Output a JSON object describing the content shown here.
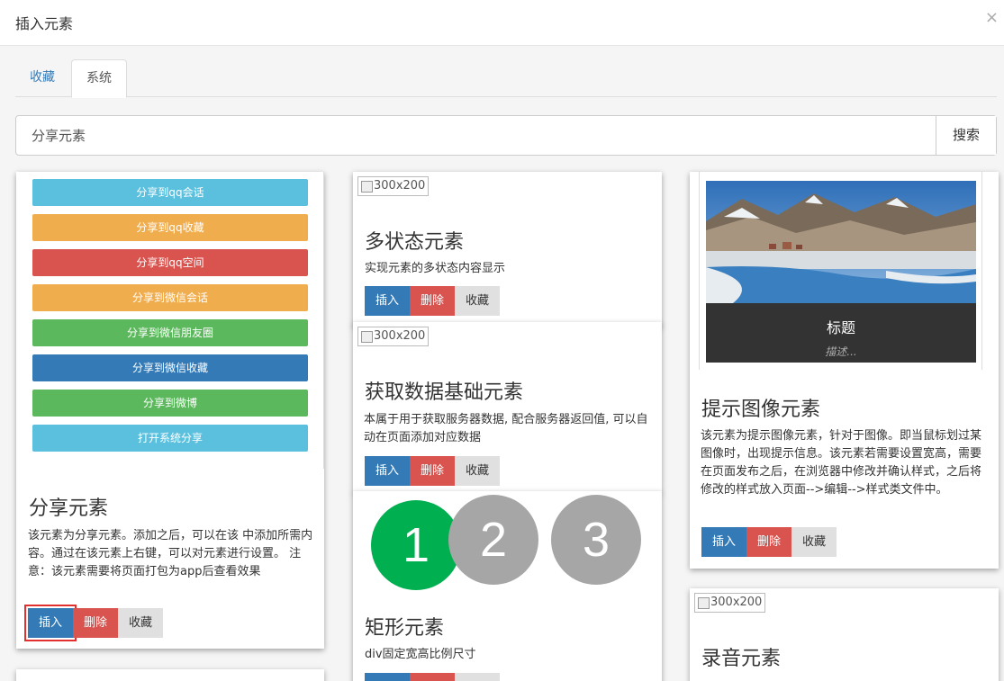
{
  "modal": {
    "title": "插入元素",
    "close": "×"
  },
  "tabs": [
    {
      "label": "收藏"
    },
    {
      "label": "系统"
    }
  ],
  "search": {
    "value": "分享元素",
    "button": "搜索"
  },
  "buttons": {
    "insert": "插入",
    "delete": "删除",
    "favorite": "收藏"
  },
  "cards": {
    "share": {
      "title": "分享元素",
      "desc": "该元素为分享元素。添加之后，可以在该 中添加所需内容。通过在该元素上右键，可以对元素进行设置。 注意：该元素需要将页面打包为app后查看效果",
      "share_buttons": [
        {
          "label": "分享到qq会话",
          "color": "#5bc0de"
        },
        {
          "label": "分享到qq收藏",
          "color": "#f0ad4e"
        },
        {
          "label": "分享到qq空间",
          "color": "#d9534f"
        },
        {
          "label": "分享到微信会话",
          "color": "#f0ad4e"
        },
        {
          "label": "分享到微信朋友圈",
          "color": "#5cb85c"
        },
        {
          "label": "分享到微信收藏",
          "color": "#337ab7"
        },
        {
          "label": "分享到微博",
          "color": "#5cb85c"
        },
        {
          "label": "打开系统分享",
          "color": "#5bc0de"
        }
      ]
    },
    "multistate": {
      "image": "300x200",
      "title": "多状态元素",
      "desc": "实现元素的多状态内容显示"
    },
    "data": {
      "image": "300x200",
      "title": "获取数据基础元素",
      "desc": "本属于用于获取服务器数据, 配合服务器返回值, 可以自动在页面添加对应数据"
    },
    "rect": {
      "circles": [
        "1",
        "2",
        "3"
      ],
      "title": "矩形元素",
      "desc": "div固定宽高比例尺寸"
    },
    "tooltip_image": {
      "caption_title": "标题",
      "caption_desc": "描述...",
      "title": "提示图像元素",
      "desc": "该元素为提示图像元素，针对于图像。即当鼠标划过某图像时，出现提示信息。该元素若需要设置宽高，需要在页面发布之后，在浏览器中修改并确认样式，之后将修改的样式放入页面-->编辑-->样式类文件中。"
    },
    "audio": {
      "image": "300x200",
      "title": "录音元素"
    }
  },
  "colors": {
    "primary": "#337ab7",
    "danger": "#d9534f",
    "active_circle": "#00b050",
    "inactive_circle": "#a6a6a6"
  }
}
